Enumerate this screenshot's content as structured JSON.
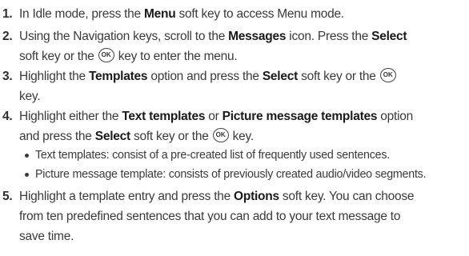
{
  "steps": [
    {
      "num": "1.",
      "parts": [
        [
          "In Idle mode, press the ",
          "t"
        ],
        [
          "Menu",
          "b"
        ],
        [
          " soft key to access Menu mode.",
          "t"
        ]
      ]
    },
    {
      "num": "2.",
      "lines": [
        [
          [
            "Using the Navigation keys, scroll to the ",
            "t"
          ],
          [
            "Messages",
            "b"
          ],
          [
            " icon. Press the ",
            "t"
          ],
          [
            "Select",
            "b"
          ]
        ],
        [
          [
            "soft key or the ",
            "t"
          ],
          [
            "OK",
            "k"
          ],
          [
            " key to enter the menu.",
            "t"
          ]
        ]
      ]
    },
    {
      "num": "3.",
      "lines": [
        [
          [
            "Highlight the ",
            "t"
          ],
          [
            "Templates",
            "b"
          ],
          [
            " option and press the ",
            "t"
          ],
          [
            "Select",
            "b"
          ],
          [
            " soft key or the ",
            "t"
          ],
          [
            "OK",
            "k"
          ]
        ],
        [
          [
            "key.",
            "t"
          ]
        ]
      ]
    },
    {
      "num": "4.",
      "lines": [
        [
          [
            "Highlight either the ",
            "t"
          ],
          [
            "Text templates",
            "b"
          ],
          [
            " or ",
            "t"
          ],
          [
            "Picture message templates",
            "b"
          ],
          [
            " option",
            "t"
          ]
        ],
        [
          [
            "and press the ",
            "t"
          ],
          [
            "Select",
            "b"
          ],
          [
            " soft key or the ",
            "t"
          ],
          [
            "OK",
            "k"
          ],
          [
            " key.",
            "t"
          ]
        ]
      ]
    },
    {
      "num": "5.",
      "lines": [
        [
          [
            "Highlight a template entry and press the ",
            "t"
          ],
          [
            "Options",
            "b"
          ],
          [
            " soft key. You can choose",
            "t"
          ]
        ],
        [
          [
            "from ten predefined sentences that you can add to your text message to",
            "t"
          ]
        ],
        [
          [
            "save time.",
            "t"
          ]
        ]
      ]
    }
  ],
  "bullets": [
    "Text templates: consist of a pre-created list of frequently used sentences.",
    "Picture message template: consists of previously created audio/video segments."
  ]
}
